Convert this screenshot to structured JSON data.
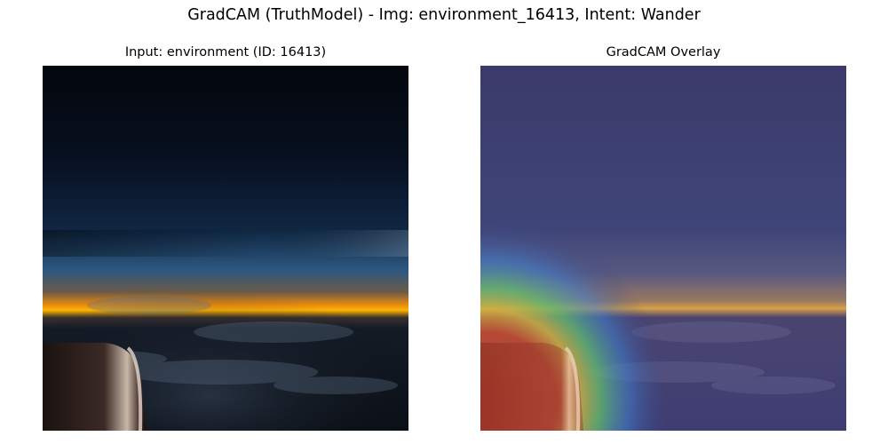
{
  "figure": {
    "title": "GradCAM (TruthModel) - Img: environment_16413, Intent: Wander"
  },
  "panels": {
    "input": {
      "title": "Input: environment (ID: 16413)"
    },
    "overlay": {
      "title": "GradCAM Overlay"
    }
  },
  "colors": {
    "night_sky_top": "#050810",
    "night_sky_mid": "#0e2038",
    "horizon_blue": "#2b5d8a",
    "horizon_orange": "#f2980d",
    "horizon_yellow": "#ffc200",
    "clouds": "#1b2536",
    "overlay_base": "#3f3f78",
    "heat_red": "#c23a2a",
    "heat_yellow": "#d8d040",
    "heat_green": "#50b878",
    "heat_cyan": "#3f7fd0"
  },
  "scene": {
    "left_image_description_icon": "airplane-window-sunset-icon",
    "right_image_description_icon": "gradcam-heatmap-icon"
  }
}
